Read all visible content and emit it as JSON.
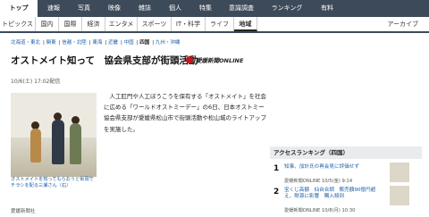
{
  "nav_primary": [
    {
      "label": "トップ",
      "active": true
    },
    {
      "label": "速報",
      "active": false
    },
    {
      "label": "写真",
      "active": false
    },
    {
      "label": "映像",
      "active": false
    },
    {
      "label": "雑誌",
      "active": false
    },
    {
      "label": "個人",
      "active": false
    },
    {
      "label": "特集",
      "active": false
    },
    {
      "label": "意識調査",
      "active": false
    },
    {
      "label": "ランキング",
      "active": false
    },
    {
      "label": "有料",
      "active": false
    }
  ],
  "nav_secondary": [
    {
      "label": "トピックス",
      "active": false
    },
    {
      "label": "国内",
      "active": false
    },
    {
      "label": "国際",
      "active": false
    },
    {
      "label": "経済",
      "active": false
    },
    {
      "label": "エンタメ",
      "active": false
    },
    {
      "label": "スポーツ",
      "active": false
    },
    {
      "label": "IT・科学",
      "active": false
    },
    {
      "label": "ライフ",
      "active": false
    },
    {
      "label": "地域",
      "active": true
    }
  ],
  "archive_label": "アーカイブ",
  "regions": [
    {
      "label": "北海道・東北",
      "current": false
    },
    {
      "label": "関東",
      "current": false
    },
    {
      "label": "信越・北陸",
      "current": false
    },
    {
      "label": "東海",
      "current": false
    },
    {
      "label": "近畿",
      "current": false
    },
    {
      "label": "中国",
      "current": false
    },
    {
      "label": "四国",
      "current": true
    },
    {
      "label": "九州・沖縄",
      "current": false
    }
  ],
  "article": {
    "headline": "オストメイト知って　協会県支部が街頭活動",
    "publisher_logo": "愛媛新聞ONLINE",
    "date": "10/6(土) 17:02配信",
    "body": "　人工肛門や人工ぼうこうを保有する「オストメイト」を社会に広める「ワールドオストミーデー」の6日、日本オストミー協会県支部が愛媛県松山市で街頭活動や松山城のライトアップを実施した。",
    "photo_caption": "オストメイトを知ってもらおうと街頭でチラシを配る三瀬さん（右）",
    "source": "愛媛新聞社"
  },
  "ranking": {
    "title": "アクセスランキング（四国）",
    "items": [
      {
        "rank": "1",
        "title": "知事、加計氏の再会見に評価せず",
        "source": "愛媛新聞ONLINE 10/5(金) 9:14"
      },
      {
        "rank": "2",
        "title": "宝くじ高額　仙台合調　販売額90億円超え、財源に影響　購入殺到",
        "source": "愛媛新聞ONLINE 10/8(月) 10:30"
      }
    ]
  }
}
